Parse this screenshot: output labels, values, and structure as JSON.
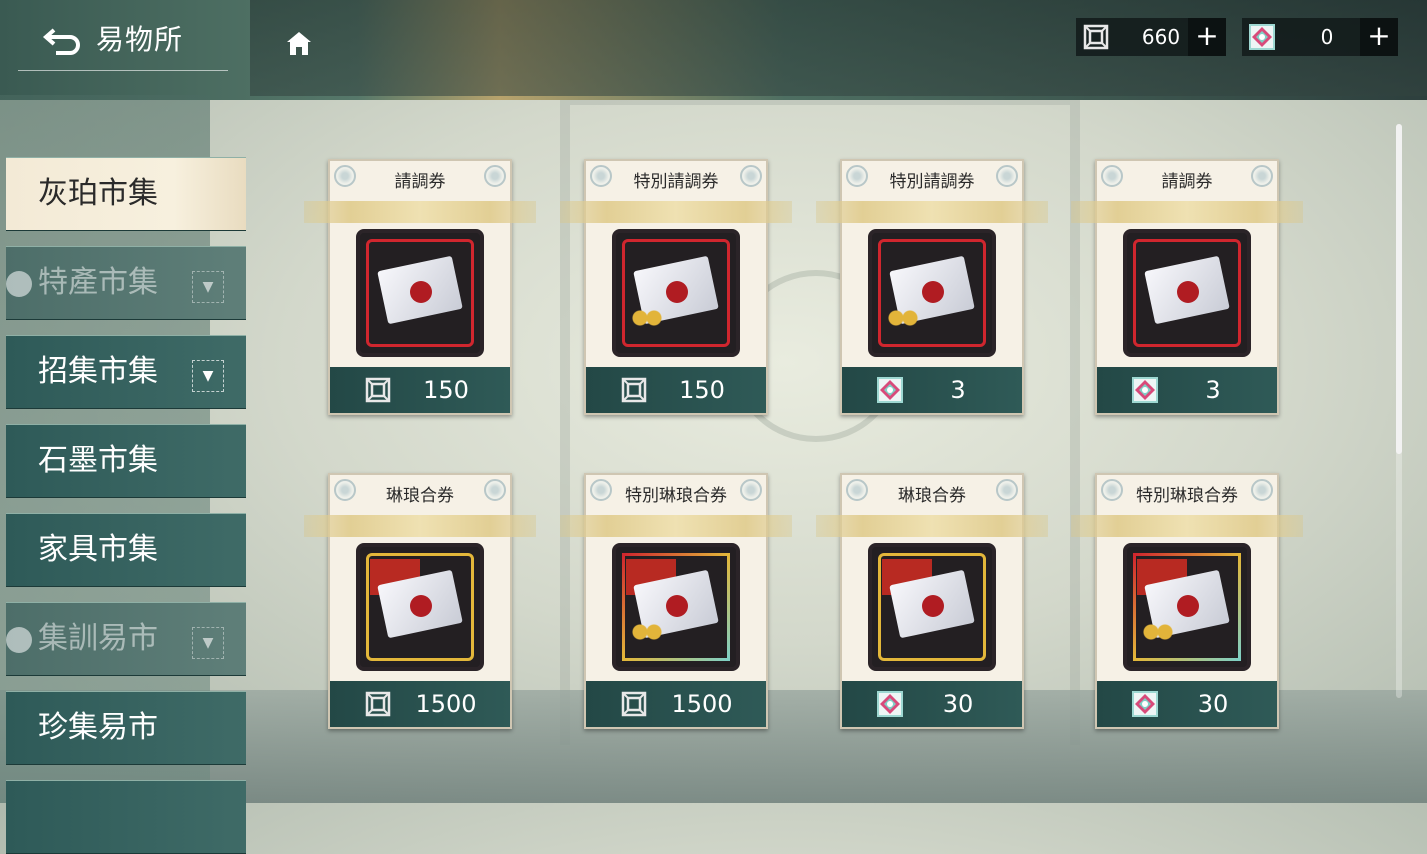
{
  "header": {
    "back_icon": "back-arrow-icon",
    "title": "易物所",
    "home_icon": "home-icon",
    "currencies": [
      {
        "icon": "coin-ticket-icon",
        "value": "660",
        "plus": "+"
      },
      {
        "icon": "gem-ticket-icon",
        "value": "0",
        "plus": "+"
      }
    ]
  },
  "sidebar": {
    "items": [
      {
        "label": "灰珀市集",
        "state": "active"
      },
      {
        "label": "特產市集",
        "state": "locked",
        "arrow": "▼"
      },
      {
        "label": "招集市集",
        "state": "normal",
        "arrow": "▼"
      },
      {
        "label": "石墨市集",
        "state": "normal"
      },
      {
        "label": "家具市集",
        "state": "normal"
      },
      {
        "label": "集訓易市",
        "state": "locked",
        "arrow": "▼"
      },
      {
        "label": "珍集易市",
        "state": "normal"
      }
    ]
  },
  "shop": {
    "items": [
      {
        "name": "請調券",
        "price": "150",
        "currency": "coin-ticket-icon",
        "image": "envelope-icon"
      },
      {
        "name": "特別請調券",
        "price": "150",
        "currency": "coin-ticket-icon",
        "image": "special-envelope-icon"
      },
      {
        "name": "特別請調券",
        "price": "3",
        "currency": "gem-ticket-icon",
        "image": "special-envelope-icon"
      },
      {
        "name": "請調券",
        "price": "3",
        "currency": "gem-ticket-icon",
        "image": "envelope-icon"
      },
      {
        "name": "琳琅合券",
        "price": "1500",
        "currency": "coin-ticket-icon",
        "image": "ticket-bundle-icon"
      },
      {
        "name": "特別琳琅合券",
        "price": "1500",
        "currency": "coin-ticket-icon",
        "image": "special-ticket-bundle-icon"
      },
      {
        "name": "琳琅合券",
        "price": "30",
        "currency": "gem-ticket-icon",
        "image": "ticket-bundle-icon"
      },
      {
        "name": "特別琳琅合券",
        "price": "30",
        "currency": "gem-ticket-icon",
        "image": "special-ticket-bundle-icon"
      }
    ]
  },
  "colors": {
    "accent_teal": "#2f5a57",
    "card_bg": "#f6f1e6",
    "ribbon_gold": "#e2cf95",
    "frame_red": "#d0262e",
    "frame_gold": "#e3b73a"
  }
}
